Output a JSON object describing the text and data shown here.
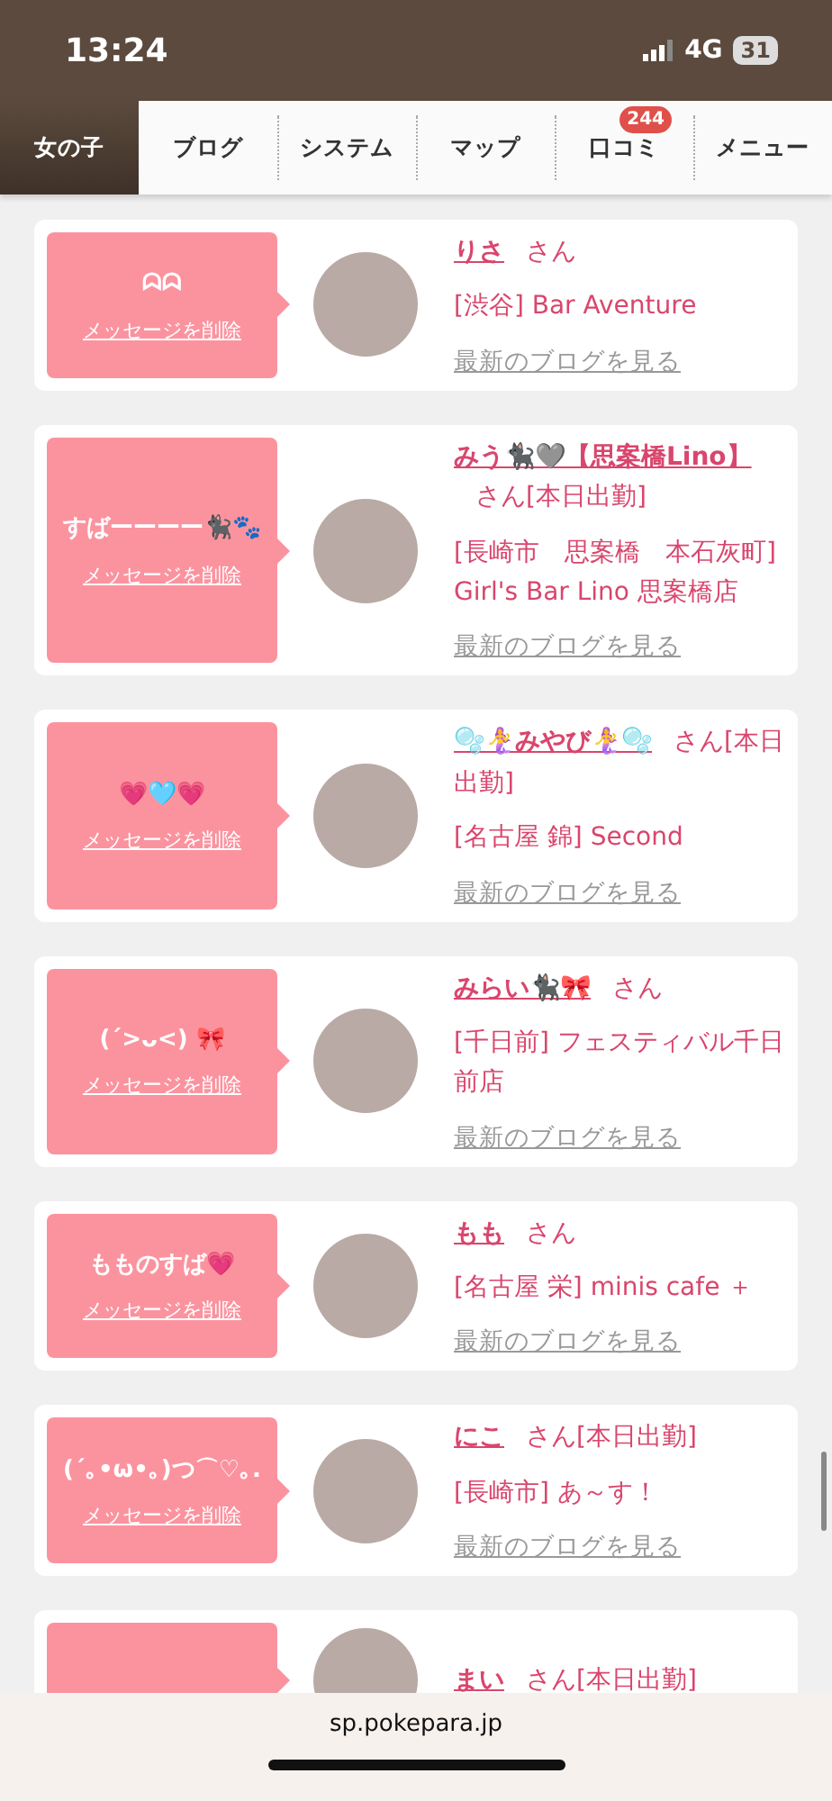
{
  "status_bar": {
    "time": "13:24",
    "network": "4G",
    "battery": "31"
  },
  "tabs": [
    {
      "label": "女の子",
      "selected": true
    },
    {
      "label": "ブログ",
      "selected": false
    },
    {
      "label": "システム",
      "selected": false
    },
    {
      "label": "マップ",
      "selected": false
    },
    {
      "label": "口コミ",
      "selected": false,
      "badge": "244"
    },
    {
      "label": "メニュー",
      "selected": false
    }
  ],
  "cards": [
    {
      "message": "ᗣᗣ",
      "delete_link": "メッセージを削除",
      "name": "りさ",
      "honorific": "さん",
      "shop": "[渋谷] Bar Aventure",
      "blog_link": "最新のブログを見る"
    },
    {
      "message": "すばーーーー🐈‍⬛🐾",
      "delete_link": "メッセージを削除",
      "name": "みう🐈‍⬛🩶【思案橋Lino】",
      "honorific": "さん",
      "tag": "[本日出勤]",
      "shop": "[長崎市　思案橋　本石灰町] Girl's Bar Lino 思案橋店",
      "blog_link": "最新のブログを見る"
    },
    {
      "message": "💗🩵💗",
      "delete_link": "メッセージを削除",
      "name": "🫧🧜‍♀️みやび🧜‍♀️🫧",
      "honorific": "さん",
      "tag": "[本日出勤]",
      "shop": "[名古屋 錦] Second",
      "blog_link": "最新のブログを見る"
    },
    {
      "message": "(ˊ>ᴗ<) 🎀",
      "delete_link": "メッセージを削除",
      "name": "みらい🐈‍⬛🎀",
      "honorific": "さん",
      "shop": "[千日前] フェスティバル千日前店",
      "blog_link": "最新のブログを見る"
    },
    {
      "message": "もものすば💗",
      "delete_link": "メッセージを削除",
      "name": "もも",
      "honorific": "さん",
      "shop": "[名古屋 栄] minis cafe ＋",
      "blog_link": "最新のブログを見る"
    },
    {
      "message": "(ˊ｡•ω•｡)つ⌒♡｡.",
      "delete_link": "メッセージを削除",
      "name": "にこ",
      "honorific": "さん",
      "tag": "[本日出勤]",
      "shop": "[長崎市] あ～す！",
      "blog_link": "最新のブログを見る"
    },
    {
      "name": "まい",
      "honorific": "さん",
      "tag": "[本日出勤]"
    }
  ],
  "browser_bar": {
    "url": "sp.pokepara.jp"
  }
}
